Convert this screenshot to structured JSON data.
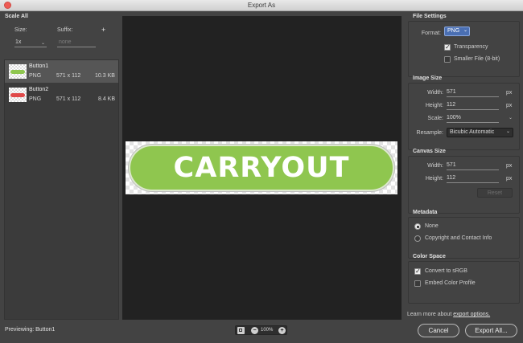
{
  "window": {
    "title": "Export As"
  },
  "left": {
    "section_title": "Scale All",
    "size_label": "Size:",
    "suffix_label": "Suffix:",
    "add_label": "+",
    "size_value": "1x",
    "suffix_placeholder": "none",
    "assets": [
      {
        "name": "Button1",
        "format": "PNG",
        "dimensions": "571 x 112",
        "filesize": "10.3 KB",
        "thumb_color": "#8fc64f"
      },
      {
        "name": "Button2",
        "format": "PNG",
        "dimensions": "571 x 112",
        "filesize": "8.4 KB",
        "thumb_color": "#e04a4a"
      }
    ]
  },
  "preview": {
    "button_text": "CARRYOUT",
    "button_color": "#8fc64f"
  },
  "file_settings": {
    "title": "File Settings",
    "format_label": "Format:",
    "format_value": "PNG",
    "transparency_label": "Transparency",
    "transparency_checked": true,
    "smaller_label": "Smaller File (8-bit)",
    "smaller_checked": false
  },
  "image_size": {
    "title": "Image Size",
    "width_label": "Width:",
    "width_value": "571",
    "height_label": "Height:",
    "height_value": "112",
    "scale_label": "Scale:",
    "scale_value": "100%",
    "resample_label": "Resample:",
    "resample_value": "Bicubic Automatic",
    "unit": "px"
  },
  "canvas_size": {
    "title": "Canvas Size",
    "width_label": "Width:",
    "width_value": "571",
    "height_label": "Height:",
    "height_value": "112",
    "unit": "px",
    "reset_label": "Reset"
  },
  "metadata": {
    "title": "Metadata",
    "options": [
      {
        "label": "None",
        "selected": true
      },
      {
        "label": "Copyright and Contact Info",
        "selected": false
      }
    ]
  },
  "color_space": {
    "title": "Color Space",
    "convert_label": "Convert to sRGB",
    "convert_checked": true,
    "embed_label": "Embed Color Profile",
    "embed_checked": false
  },
  "learn_more": {
    "prefix": "Learn more about ",
    "link": "export options."
  },
  "footer": {
    "previewing": "Previewing: Button1",
    "zoom_value": "100%",
    "zoom_out": "−",
    "zoom_in": "+",
    "cancel_label": "Cancel",
    "export_label": "Export All..."
  },
  "colors": {
    "accent": "#4a6fb3",
    "panel": "#434343",
    "preview_bg": "#222222"
  }
}
